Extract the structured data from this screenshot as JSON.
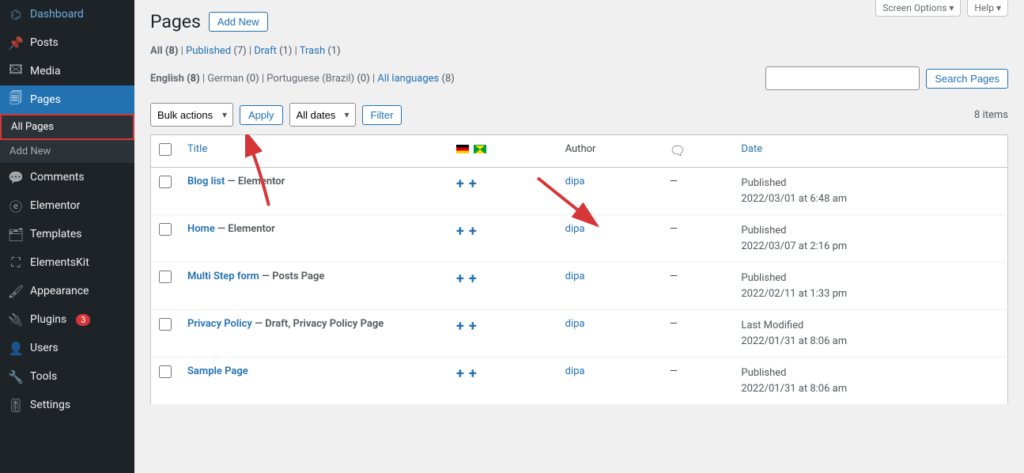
{
  "top_tabs": {
    "screen_options": "Screen Options",
    "help": "Help"
  },
  "sidebar": {
    "dashboard": "Dashboard",
    "posts": "Posts",
    "media": "Media",
    "pages": "Pages",
    "all_pages": "All Pages",
    "add_new_sub": "Add New",
    "comments": "Comments",
    "elementor": "Elementor",
    "templates": "Templates",
    "elementskit": "ElementsKit",
    "appearance": "Appearance",
    "plugins": "Plugins",
    "plugins_badge": "3",
    "users": "Users",
    "tools": "Tools",
    "settings": "Settings"
  },
  "header": {
    "title": "Pages",
    "add_new": "Add New"
  },
  "status_filters": {
    "all": "All",
    "all_count": "(8)",
    "published": "Published",
    "published_count": "(7)",
    "draft": "Draft",
    "draft_count": "(1)",
    "trash": "Trash",
    "trash_count": "(1)"
  },
  "lang_filters": {
    "english": "English",
    "english_count": "(8)",
    "german": "German",
    "german_count": "(0)",
    "portuguese": "Portuguese (Brazil)",
    "portuguese_count": "(0)",
    "all_langs": "All languages",
    "all_langs_count": "(8)"
  },
  "search": {
    "button": "Search Pages"
  },
  "bulk": {
    "actions": "Bulk actions",
    "apply": "Apply",
    "all_dates": "All dates",
    "filter": "Filter"
  },
  "count": "8 items",
  "columns": {
    "title": "Title",
    "author": "Author",
    "date": "Date"
  },
  "rows": [
    {
      "title": "Blog list",
      "meta": " — Elementor",
      "author": "dipa",
      "comments": "—",
      "date_label": "Published",
      "date": "2022/03/01 at 6:48 am"
    },
    {
      "title": "Home",
      "meta": " — Elementor",
      "author": "dipa",
      "comments": "—",
      "date_label": "Published",
      "date": "2022/03/07 at 2:16 pm"
    },
    {
      "title": "Multi Step form",
      "meta": " — Posts Page",
      "author": "dipa",
      "comments": "—",
      "date_label": "Published",
      "date": "2022/02/11 at 1:33 pm"
    },
    {
      "title": "Privacy Policy",
      "meta": " — Draft, Privacy Policy Page",
      "author": "dipa",
      "comments": "—",
      "date_label": "Last Modified",
      "date": "2022/01/31 at 8:06 am"
    },
    {
      "title": "Sample Page",
      "meta": "",
      "author": "dipa",
      "comments": "—",
      "date_label": "Published",
      "date": "2022/01/31 at 8:06 am"
    }
  ]
}
